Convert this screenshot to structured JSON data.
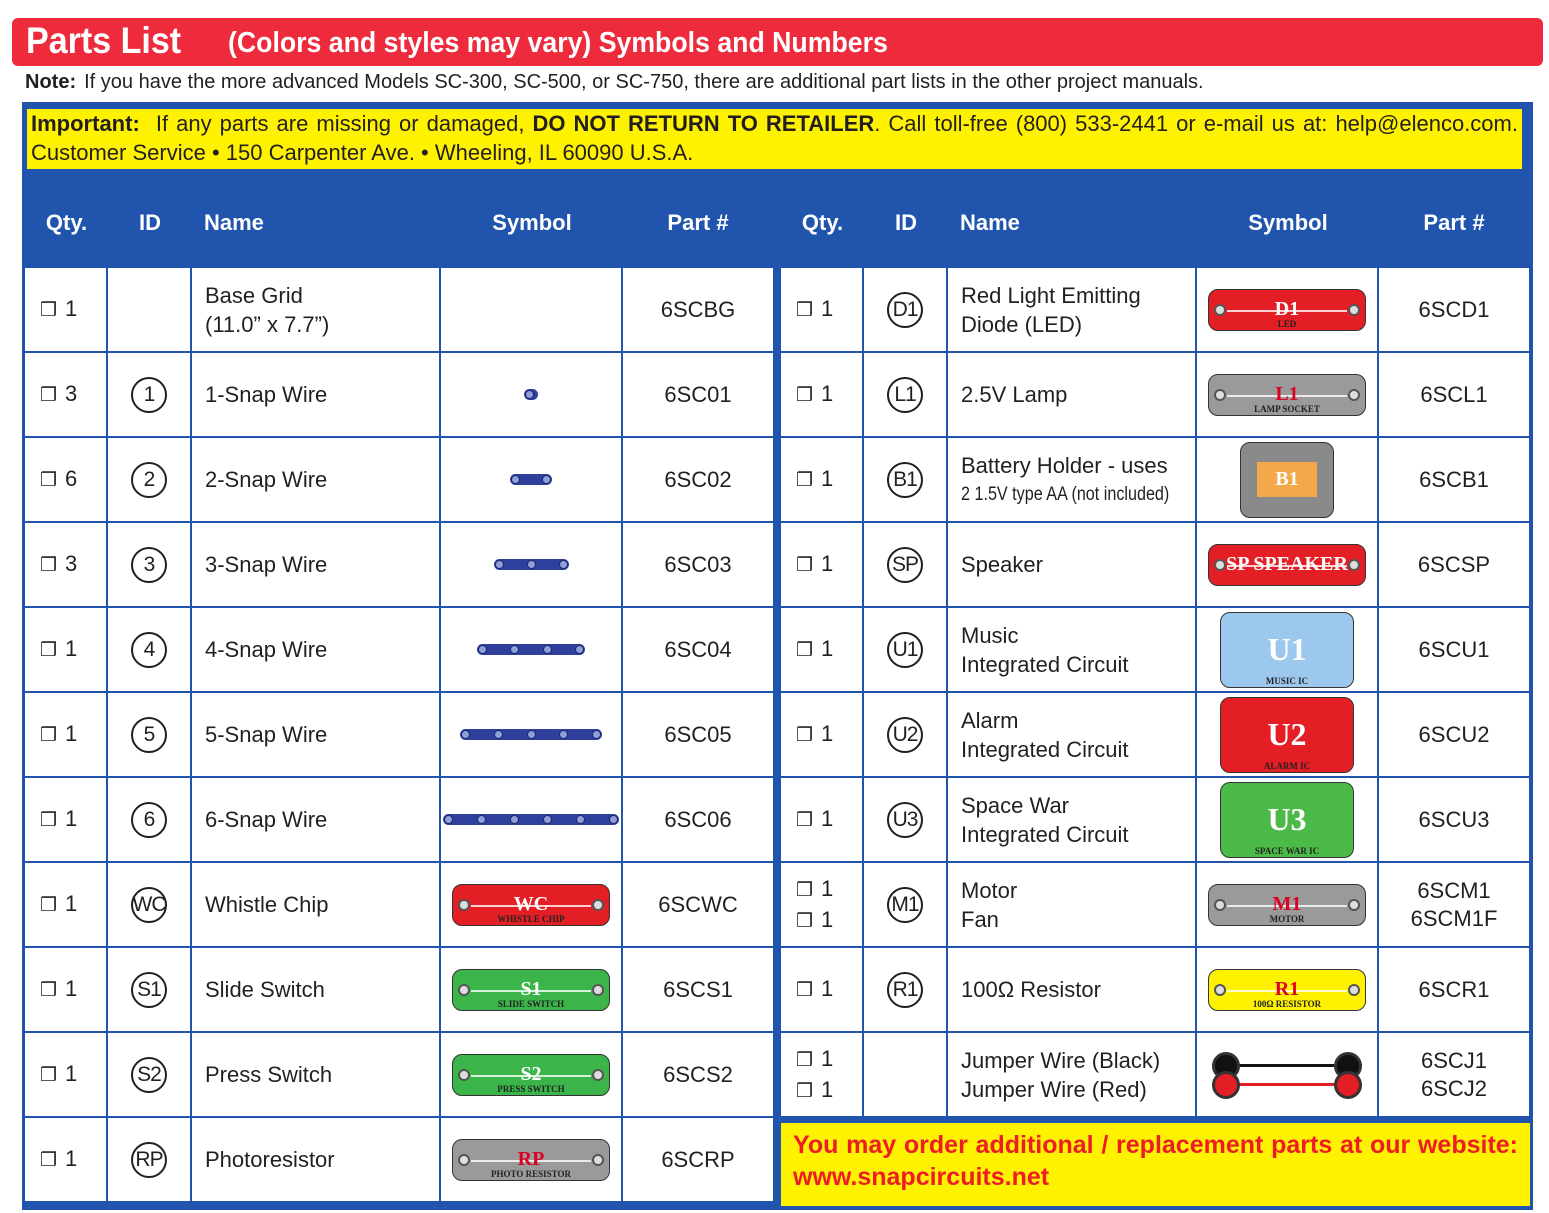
{
  "title": {
    "main": "Parts List",
    "sub": "(Colors and styles may vary) Symbols and Numbers"
  },
  "note": {
    "label": "Note:",
    "text": "If you have the more advanced Models SC-300, SC-500, or SC-750, there are additional part lists in the other project manuals."
  },
  "important": {
    "label": "Important:",
    "text1": "If any parts are missing or damaged,",
    "bold": "DO NOT RETURN TO RETAILER",
    "text2": ". Call toll-free (800) 533-2441 or e-mail us at: help@elenco.com. Customer Service • 150 Carpenter Ave. • Wheeling, IL 60090 U.S.A."
  },
  "headers": [
    "Qty.",
    "ID",
    "Name",
    "Symbol",
    "Part #"
  ],
  "checkbox_glyph": "❒",
  "left_rows": [
    {
      "qty": [
        "1"
      ],
      "id": "",
      "name": [
        "Base Grid",
        "(11.0” x 7.7”)"
      ],
      "symbol": {
        "kind": "none"
      },
      "part": [
        "6SCBG"
      ]
    },
    {
      "qty": [
        "3"
      ],
      "id": "1",
      "name": [
        "1-Snap Wire"
      ],
      "symbol": {
        "kind": "wire",
        "snaps": 1
      },
      "part": [
        "6SC01"
      ]
    },
    {
      "qty": [
        "6"
      ],
      "id": "2",
      "name": [
        "2-Snap Wire"
      ],
      "symbol": {
        "kind": "wire",
        "snaps": 2
      },
      "part": [
        "6SC02"
      ]
    },
    {
      "qty": [
        "3"
      ],
      "id": "3",
      "name": [
        "3-Snap Wire"
      ],
      "symbol": {
        "kind": "wire",
        "snaps": 3
      },
      "part": [
        "6SC03"
      ]
    },
    {
      "qty": [
        "1"
      ],
      "id": "4",
      "name": [
        "4-Snap Wire"
      ],
      "symbol": {
        "kind": "wire",
        "snaps": 4
      },
      "part": [
        "6SC04"
      ]
    },
    {
      "qty": [
        "1"
      ],
      "id": "5",
      "name": [
        "5-Snap Wire"
      ],
      "symbol": {
        "kind": "wire",
        "snaps": 5
      },
      "part": [
        "6SC05"
      ]
    },
    {
      "qty": [
        "1"
      ],
      "id": "6",
      "name": [
        "6-Snap Wire"
      ],
      "symbol": {
        "kind": "wire",
        "snaps": 6
      },
      "part": [
        "6SC06"
      ]
    },
    {
      "qty": [
        "1"
      ],
      "id": "WC",
      "name": [
        "Whistle Chip"
      ],
      "symbol": {
        "kind": "piece",
        "color": "#e31e24",
        "label": "WC",
        "sub": "WHISTLE CHIP"
      },
      "part": [
        "6SCWC"
      ]
    },
    {
      "qty": [
        "1"
      ],
      "id": "S1",
      "name": [
        "Slide Switch"
      ],
      "symbol": {
        "kind": "piece",
        "color": "#3bb54a",
        "label": "S1",
        "sub": "SLIDE    SWITCH"
      },
      "part": [
        "6SCS1"
      ]
    },
    {
      "qty": [
        "1"
      ],
      "id": "S2",
      "name": [
        "Press Switch"
      ],
      "symbol": {
        "kind": "piece",
        "color": "#3bb54a",
        "label": "S2",
        "sub": "PRESS    SWITCH"
      },
      "part": [
        "6SCS2"
      ]
    },
    {
      "qty": [
        "1"
      ],
      "id": "RP",
      "name": [
        "Photoresistor"
      ],
      "symbol": {
        "kind": "piece",
        "color": "#9a9a9a",
        "label": "RP",
        "sub": "PHOTO    RESISTOR"
      },
      "part": [
        "6SCRP"
      ]
    }
  ],
  "right_rows": [
    {
      "qty": [
        "1"
      ],
      "id": "D1",
      "name": [
        "Red Light Emitting",
        "Diode (LED)"
      ],
      "symbol": {
        "kind": "piece",
        "color": "#e31e24",
        "label": "D1",
        "sub": "LED"
      },
      "part": [
        "6SCD1"
      ]
    },
    {
      "qty": [
        "1"
      ],
      "id": "L1",
      "name": [
        "2.5V Lamp"
      ],
      "symbol": {
        "kind": "piece",
        "color": "#9a9a9a",
        "label": "L1",
        "sub": "LAMP    SOCKET"
      },
      "part": [
        "6SCL1"
      ]
    },
    {
      "qty": [
        "1"
      ],
      "id": "B1",
      "name": [
        "Battery Holder - uses",
        "2 1.5V type AA (not included)"
      ],
      "symbol": {
        "kind": "battery",
        "color": "#8a8a8a",
        "label": "B1"
      },
      "part": [
        "6SCB1"
      ]
    },
    {
      "qty": [
        "1"
      ],
      "id": "SP",
      "name": [
        "Speaker"
      ],
      "symbol": {
        "kind": "piece",
        "color": "#e31e24",
        "label": "SP SPEAKER",
        "sub": ""
      },
      "part": [
        "6SCSP"
      ]
    },
    {
      "qty": [
        "1"
      ],
      "id": "U1",
      "name": [
        "Music",
        "Integrated Circuit"
      ],
      "symbol": {
        "kind": "ic",
        "color": "#9dc8ee",
        "label": "U1",
        "sub": "MUSIC IC"
      },
      "part": [
        "6SCU1"
      ]
    },
    {
      "qty": [
        "1"
      ],
      "id": "U2",
      "name": [
        "Alarm",
        "Integrated Circuit"
      ],
      "symbol": {
        "kind": "ic",
        "color": "#e31e24",
        "label": "U2",
        "sub": "ALARM IC"
      },
      "part": [
        "6SCU2"
      ]
    },
    {
      "qty": [
        "1"
      ],
      "id": "U3",
      "name": [
        "Space War",
        "Integrated Circuit"
      ],
      "symbol": {
        "kind": "ic",
        "color": "#4cba48",
        "label": "U3",
        "sub": "SPACE WAR IC"
      },
      "part": [
        "6SCU3"
      ]
    },
    {
      "qty": [
        "1",
        "1"
      ],
      "id": "M1",
      "name": [
        "Motor",
        "Fan"
      ],
      "symbol": {
        "kind": "piece",
        "color": "#9a9a9a",
        "label": "M1",
        "sub": "MOTOR"
      },
      "part": [
        "6SCM1",
        "6SCM1F"
      ]
    },
    {
      "qty": [
        "1"
      ],
      "id": "R1",
      "name": [
        "100Ω Resistor"
      ],
      "symbol": {
        "kind": "piece",
        "color": "#fff200",
        "label": "R1",
        "sub": "100Ω    RESISTOR"
      },
      "part": [
        "6SCR1"
      ]
    },
    {
      "qty": [
        "1",
        "1"
      ],
      "id": "",
      "name": [
        "Jumper Wire (Black)",
        "Jumper Wire (Red)"
      ],
      "symbol": {
        "kind": "jumper",
        "colors": [
          "#111111",
          "#e31e24"
        ]
      },
      "part": [
        "6SCJ1",
        "6SCJ2"
      ]
    }
  ],
  "footer": "You may order additional / replacement parts at our website: www.snapcircuits.net"
}
